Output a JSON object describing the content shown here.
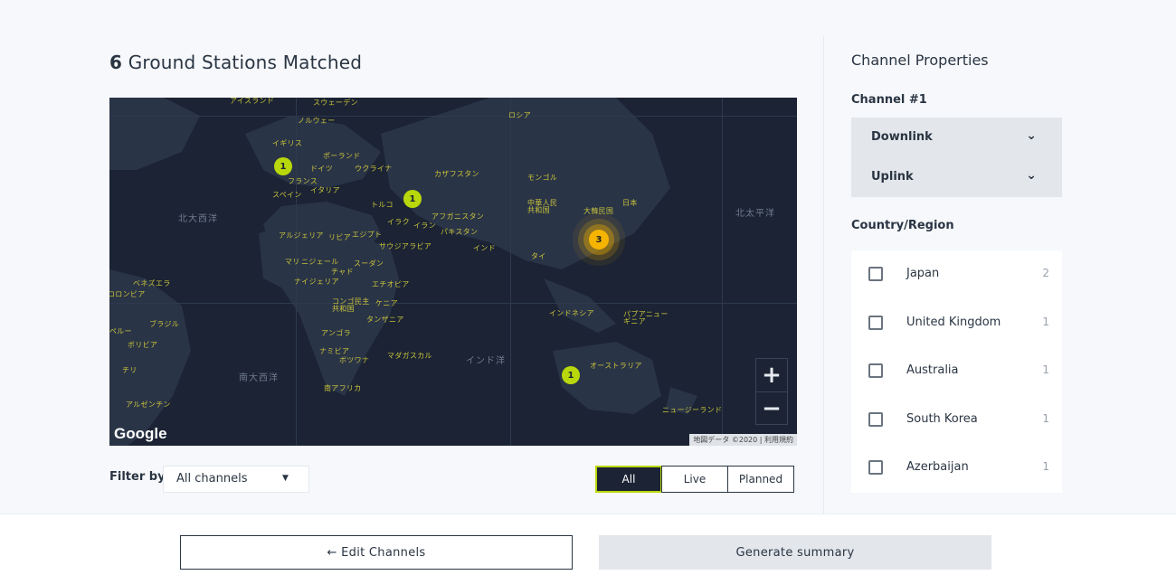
{
  "header": {
    "count": "6",
    "title_rest": "Ground Stations Matched"
  },
  "map": {
    "country_labels": [
      "アイスランド",
      "スウェーデン",
      "ノルウェー",
      "イギリス",
      "ポーランド",
      "ドイツ",
      "ウクライナ",
      "フランス",
      "イタリア",
      "スペイン",
      "カザフスタン",
      "ロシア",
      "モンゴル",
      "トルコ",
      "イラク",
      "イラン",
      "アフガニスタン",
      "パキスタン",
      "中華人民共和国",
      "大韓民国",
      "日本",
      "アルジェリア",
      "リビア",
      "エジプト",
      "サウジアラビア",
      "インド",
      "タイ",
      "マリ",
      "ニジェール",
      "チャド",
      "スーダン",
      "ナイジェリア",
      "エチオピア",
      "ベネズエラ",
      "コロンビア",
      "コンゴ民主共和国",
      "ケニア",
      "タンザニア",
      "インドネシア",
      "パプアニューギニア",
      "ブラジル",
      "ペルー",
      "ボリビア",
      "アンゴラ",
      "ナミビア",
      "ボツワナ",
      "マダガスカル",
      "チリ",
      "オーストラリア",
      "南アフリカ",
      "アルゼンチン",
      "ニュージーランド"
    ],
    "ocean_labels": [
      "北大西洋",
      "北太平洋",
      "南大西洋",
      "インド洋"
    ],
    "clusters": [
      "1",
      "1",
      "3",
      "1"
    ],
    "zoom_in": "+",
    "zoom_out": "−",
    "logo": "Google",
    "attribution": "地図データ ©2020 | 利用規約"
  },
  "filter": {
    "label": "Filter by",
    "selected": "All channels",
    "caret": "▼"
  },
  "segments": [
    "All",
    "Live",
    "Planned"
  ],
  "sidebar": {
    "title": "Channel Properties",
    "channel": "Channel #1",
    "dropdowns": [
      "Downlink",
      "Uplink"
    ],
    "region_label": "Country/Region",
    "regions": [
      {
        "name": "Japan",
        "count": "2"
      },
      {
        "name": "United Kingdom",
        "count": "1"
      },
      {
        "name": "Australia",
        "count": "1"
      },
      {
        "name": "South Korea",
        "count": "1"
      },
      {
        "name": "Azerbaijan",
        "count": "1"
      }
    ]
  },
  "footer": {
    "edit_label": "← Edit Channels",
    "generate_label": "Generate summary"
  }
}
